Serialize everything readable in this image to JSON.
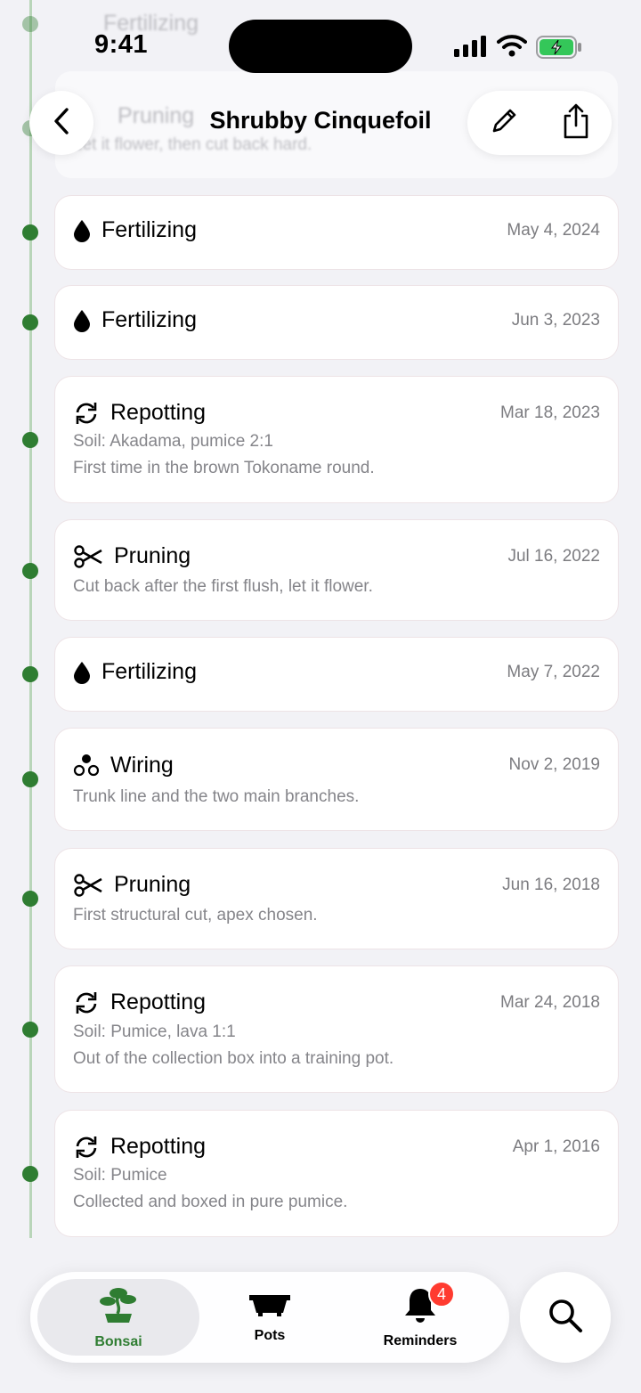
{
  "status_bar": {
    "time": "9:41"
  },
  "nav": {
    "title": "Shrubby Cinquefoil",
    "behind_card": {
      "title": "Pruning",
      "note": "Let it flower, then cut back hard.",
      "top_title": "Fertilizing"
    }
  },
  "entries": [
    {
      "icon": "drop-icon",
      "title": "Fertilizing",
      "date": "May 4, 2024"
    },
    {
      "icon": "drop-icon",
      "title": "Fertilizing",
      "date": "Jun 3, 2023"
    },
    {
      "icon": "repot-icon",
      "title": "Repotting",
      "date": "Mar 18, 2023",
      "soil": "Soil: Akadama, pumice 2:1",
      "note": "First time in the brown Tokoname round."
    },
    {
      "icon": "scissors-icon",
      "title": "Pruning",
      "date": "Jul 16, 2022",
      "note": "Cut back after the first flush, let it flower."
    },
    {
      "icon": "drop-icon",
      "title": "Fertilizing",
      "date": "May 7, 2022"
    },
    {
      "icon": "wiring-icon",
      "title": "Wiring",
      "date": "Nov 2, 2019",
      "note": "Trunk line and the two main branches."
    },
    {
      "icon": "scissors-icon",
      "title": "Pruning",
      "date": "Jun 16, 2018",
      "note": "First structural cut, apex chosen."
    },
    {
      "icon": "repot-icon",
      "title": "Repotting",
      "date": "Mar 24, 2018",
      "soil": "Soil: Pumice, lava 1:1",
      "note": "Out of the collection box into a training pot."
    },
    {
      "icon": "repot-icon",
      "title": "Repotting",
      "date": "Apr 1, 2016",
      "soil": "Soil: Pumice",
      "note": "Collected and boxed in pure pumice."
    }
  ],
  "tabbar": {
    "tabs": [
      {
        "label": "Bonsai",
        "icon": "bonsai-icon",
        "selected": true
      },
      {
        "label": "Pots",
        "icon": "pot-icon"
      },
      {
        "label": "Reminders",
        "icon": "bell-icon",
        "badge": "4"
      }
    ]
  },
  "colors": {
    "accent": "#2f7d32",
    "rail": "#b9d5b9",
    "badge": "#ff3b30",
    "background": "#f2f2f6"
  }
}
